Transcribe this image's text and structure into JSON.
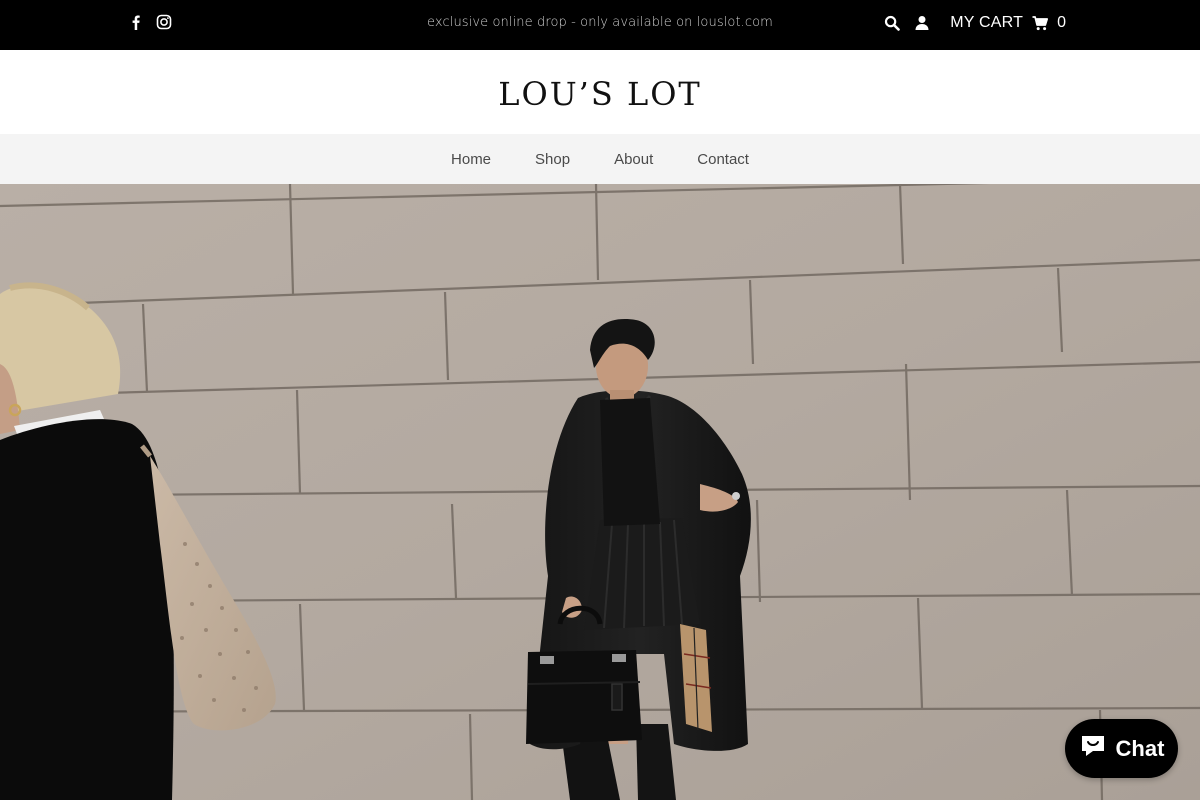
{
  "topbar": {
    "announcement": "exclusive online drop - only available on louslot.com",
    "social": [
      {
        "icon": "facebook-icon"
      },
      {
        "icon": "instagram-icon"
      }
    ],
    "cart_label": "MY CART",
    "cart_count": "0",
    "icons": [
      "search-icon",
      "user-icon",
      "cart-icon"
    ]
  },
  "header": {
    "logo": "LOU’S LOT"
  },
  "nav": {
    "items": [
      {
        "label": "Home"
      },
      {
        "label": "Shop"
      },
      {
        "label": "About"
      },
      {
        "label": "Contact"
      }
    ]
  },
  "chat": {
    "label": "Chat"
  },
  "colors": {
    "topbar_bg": "#000000",
    "nav_bg": "#f4f4f4",
    "wall": "#b5aba2"
  }
}
